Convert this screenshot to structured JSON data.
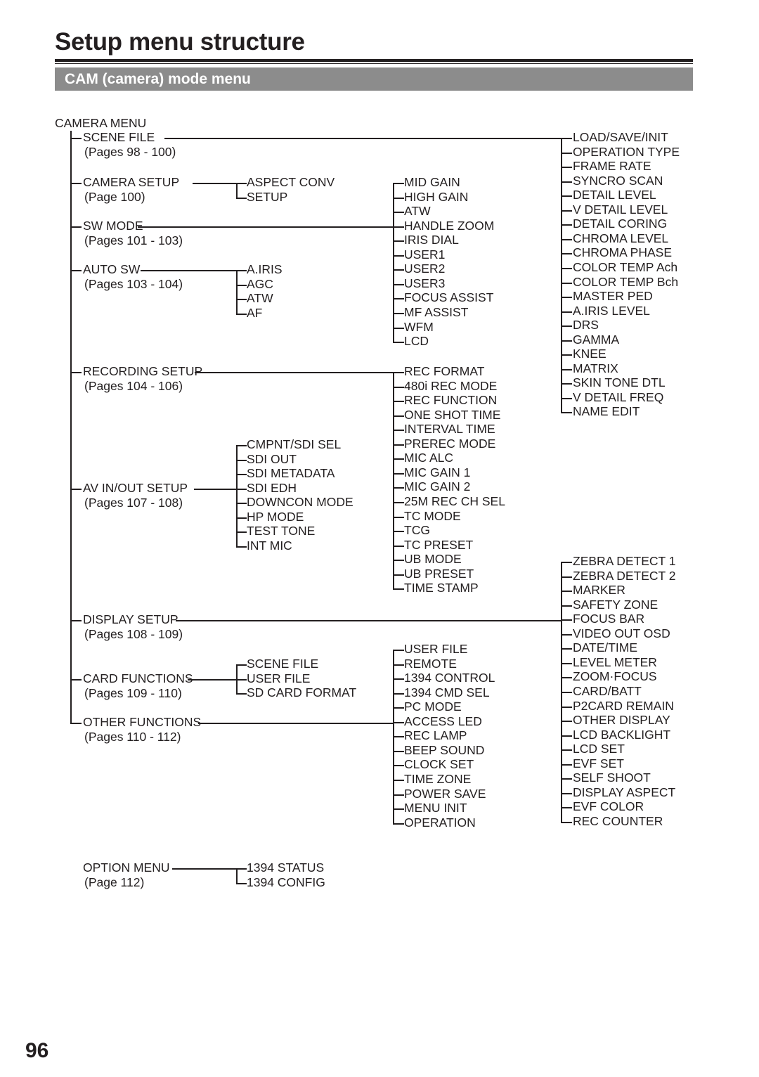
{
  "header": {
    "title": "Setup menu structure",
    "section_bar": "CAM (camera) mode menu"
  },
  "footer": {
    "page_number": "96"
  },
  "tree": {
    "root_label": "CAMERA MENU",
    "level1": [
      {
        "label": "SCENE FILE",
        "pages": "(Pages 98 - 100)"
      },
      {
        "label": "CAMERA SETUP",
        "pages": "(Page 100)"
      },
      {
        "label": "SW MODE",
        "pages": "(Pages 101 - 103)"
      },
      {
        "label": "AUTO SW",
        "pages": "(Pages 103 - 104)"
      },
      {
        "label": "RECORDING SETUP",
        "pages": "(Pages 104 - 106)"
      },
      {
        "label": "AV IN/OUT SETUP",
        "pages": "(Pages 107 - 108)"
      },
      {
        "label": "DISPLAY SETUP",
        "pages": "(Pages 108 - 109)"
      },
      {
        "label": "CARD FUNCTIONS",
        "pages": "(Pages 109 - 110)"
      },
      {
        "label": "OTHER FUNCTIONS",
        "pages": "(Pages 110 - 112)"
      }
    ],
    "camera_setup_children": [
      "ASPECT CONV",
      "SETUP"
    ],
    "auto_sw_children": [
      "A.IRIS",
      "AGC",
      "ATW",
      "AF"
    ],
    "sw_mode_children": [
      "MID GAIN",
      "HIGH GAIN",
      "ATW",
      "HANDLE ZOOM",
      "IRIS DIAL",
      "USER1",
      "USER2",
      "USER3",
      "FOCUS ASSIST",
      "MF ASSIST",
      "WFM",
      "LCD"
    ],
    "scene_file_children": [
      "LOAD/SAVE/INIT",
      "OPERATION TYPE",
      "FRAME RATE",
      "SYNCRO SCAN",
      "DETAIL LEVEL",
      "V DETAIL LEVEL",
      "DETAIL CORING",
      "CHROMA LEVEL",
      "CHROMA PHASE",
      "COLOR TEMP Ach",
      "COLOR TEMP Bch",
      "MASTER PED",
      "A.IRIS LEVEL",
      "DRS",
      "GAMMA",
      "KNEE",
      "MATRIX",
      "SKIN TONE DTL",
      "V DETAIL FREQ",
      "NAME EDIT"
    ],
    "recording_setup_children": [
      "REC FORMAT",
      "480i REC MODE",
      "REC FUNCTION",
      "ONE SHOT TIME",
      "INTERVAL TIME",
      "PREREC MODE",
      "MIC ALC",
      "MIC GAIN 1",
      "MIC GAIN 2",
      "25M REC CH SEL",
      "TC MODE",
      "TCG",
      "TC PRESET",
      "UB MODE",
      "UB PRESET",
      "TIME STAMP"
    ],
    "av_inout_children": [
      "CMPNT/SDI SEL",
      "SDI OUT",
      "SDI METADATA",
      "SDI EDH",
      "DOWNCON MODE",
      "HP MODE",
      "TEST TONE",
      "INT MIC"
    ],
    "display_setup_children": [
      "ZEBRA DETECT 1",
      "ZEBRA DETECT 2",
      "MARKER",
      "SAFETY ZONE",
      "FOCUS BAR",
      "VIDEO OUT OSD",
      "DATE/TIME",
      "LEVEL METER",
      "ZOOM·FOCUS",
      "CARD/BATT",
      "P2CARD REMAIN",
      "OTHER DISPLAY",
      "LCD BACKLIGHT",
      "LCD SET",
      "EVF SET",
      "SELF SHOOT",
      "DISPLAY ASPECT",
      "EVF COLOR",
      "REC COUNTER"
    ],
    "card_functions_children": [
      "SCENE FILE",
      "USER FILE",
      "SD CARD FORMAT"
    ],
    "other_functions_children": [
      "USER FILE",
      "REMOTE",
      "1394 CONTROL",
      "1394 CMD SEL",
      "PC MODE",
      "ACCESS LED",
      "REC LAMP",
      "BEEP SOUND",
      "CLOCK SET",
      "TIME ZONE",
      "POWER SAVE",
      "MENU INIT",
      "OPERATION"
    ],
    "option_menu": {
      "label": "OPTION MENU",
      "pages": "(Page 112)",
      "children": [
        "1394 STATUS",
        "1394 CONFIG"
      ]
    }
  }
}
